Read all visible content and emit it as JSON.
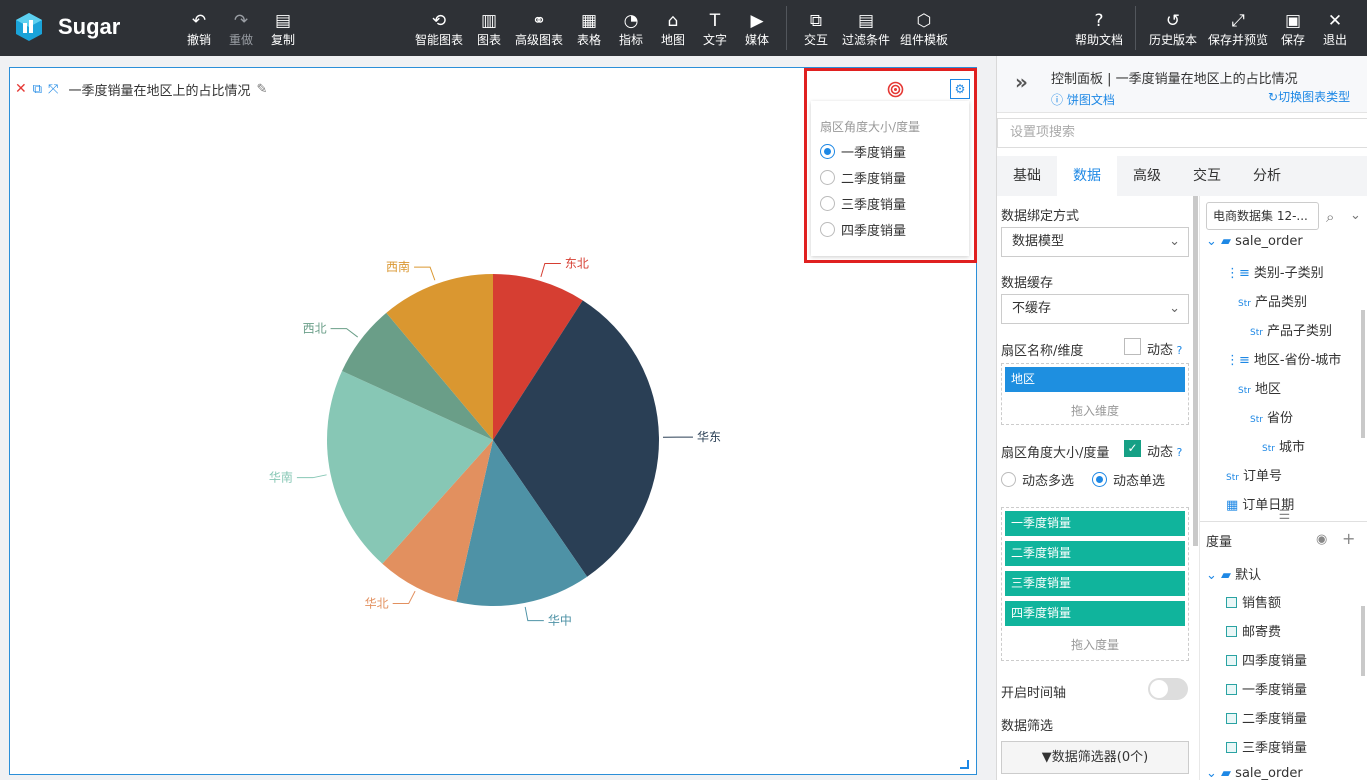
{
  "app": {
    "name": "Sugar"
  },
  "toolbar": {
    "undo": "撤销",
    "redo": "重做",
    "copy": "复制",
    "smart_chart": "智能图表",
    "chart": "图表",
    "advanced_chart": "高级图表",
    "table": "表格",
    "indicator": "指标",
    "map": "地图",
    "text": "文字",
    "media": "媒体",
    "interaction": "交互",
    "filter": "过滤条件",
    "component_template": "组件模板",
    "help": "帮助文档",
    "history": "历史版本",
    "save_preview": "保存并预览",
    "save": "保存",
    "exit": "退出"
  },
  "widget": {
    "title": "一季度销量在地区上的占比情况"
  },
  "popup": {
    "title": "扇区角度大小/度量",
    "options": [
      "一季度销量",
      "二季度销量",
      "三季度销量",
      "四季度销量"
    ],
    "selected": "一季度销量"
  },
  "chart_data": {
    "type": "pie",
    "categories": [
      "东北",
      "华东",
      "华中",
      "华北",
      "华南",
      "西北",
      "西南"
    ],
    "values": [
      9,
      31,
      13,
      8,
      20,
      7,
      11
    ],
    "colors": [
      "#d63e32",
      "#2a3f55",
      "#4e92a6",
      "#e2905f",
      "#87c7b5",
      "#6a9e88",
      "#da9730"
    ]
  },
  "panel": {
    "title": "控制面板 | 一季度销量在地区上的占比情况",
    "doc_link": "饼图文档",
    "switch_link": "切换图表类型",
    "search_placeholder": "设置项搜索",
    "tabs": [
      "基础",
      "数据",
      "高级",
      "交互",
      "分析"
    ],
    "active_tab": "数据",
    "binding_label": "数据绑定方式",
    "binding_value": "数据模型",
    "cache_label": "数据缓存",
    "cache_value": "不缓存",
    "dimension_label": "扇区名称/维度",
    "dynamic": "动态",
    "dimension_chip": "地区",
    "drag_dimension": "拖入维度",
    "measure_label": "扇区角度大小/度量",
    "multi": "动态多选",
    "single": "动态单选",
    "measure_chips": [
      "一季度销量",
      "二季度销量",
      "三季度销量",
      "四季度销量"
    ],
    "drag_measure": "拖入度量",
    "timeline": "开启时间轴",
    "data_filter": "数据筛选",
    "filter_btn": "数据筛选器(0个)",
    "dataset": "电商数据集 12-...",
    "tree_root": "sale_order",
    "tree_items": [
      "类别-子类别",
      "产品类别",
      "产品子类别",
      "地区-省份-城市",
      "地区",
      "省份",
      "城市",
      "订单号",
      "订单日期"
    ],
    "measure_section": "度量",
    "default_folder": "默认",
    "measures": [
      "销售额",
      "邮寄费",
      "四季度销量",
      "一季度销量",
      "二季度销量",
      "三季度销量"
    ],
    "tree_root2": "sale_order"
  }
}
